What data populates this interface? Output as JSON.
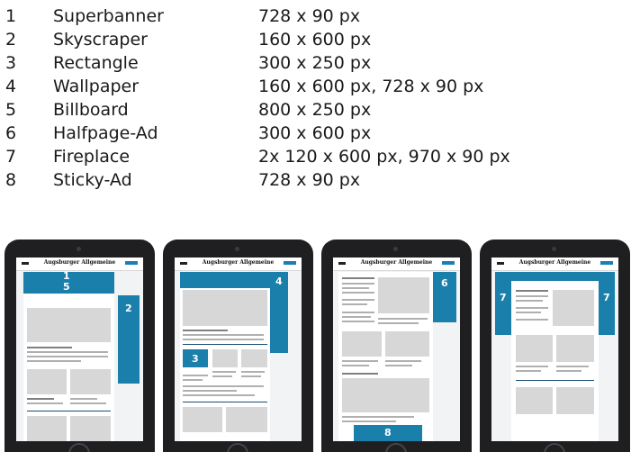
{
  "formats": [
    {
      "number": "1",
      "name": "Superbanner",
      "size": "728 x 90 px"
    },
    {
      "number": "2",
      "name": "Skyscraper",
      "size": "160 x 600 px"
    },
    {
      "number": "3",
      "name": "Rectangle",
      "size": "300 x 250 px"
    },
    {
      "number": "4",
      "name": "Wallpaper",
      "size": "160 x 600 px, 728 x 90 px"
    },
    {
      "number": "5",
      "name": "Billboard",
      "size": "800 x 250 px"
    },
    {
      "number": "6",
      "name": "Halfpage-Ad",
      "size": "300 x 600 px"
    },
    {
      "number": "7",
      "name": "Fireplace",
      "size": "2x 120 x 600 px, 970 x 90 px"
    },
    {
      "number": "8",
      "name": "Sticky-Ad",
      "size": "728 x 90 px"
    }
  ],
  "site_logo": "Augsburger Allgemeine",
  "colors": {
    "ad_blue": "#1a7faa",
    "ad_light_blue": "#9fc8dc",
    "tablet_frame": "#1f1f21"
  },
  "tablets": {
    "t1": {
      "labels": [
        "1",
        "5",
        "2"
      ]
    },
    "t2": {
      "labels": [
        "4",
        "3"
      ]
    },
    "t3": {
      "labels": [
        "6",
        "8"
      ]
    },
    "t4": {
      "labels": [
        "7",
        "7"
      ]
    }
  }
}
